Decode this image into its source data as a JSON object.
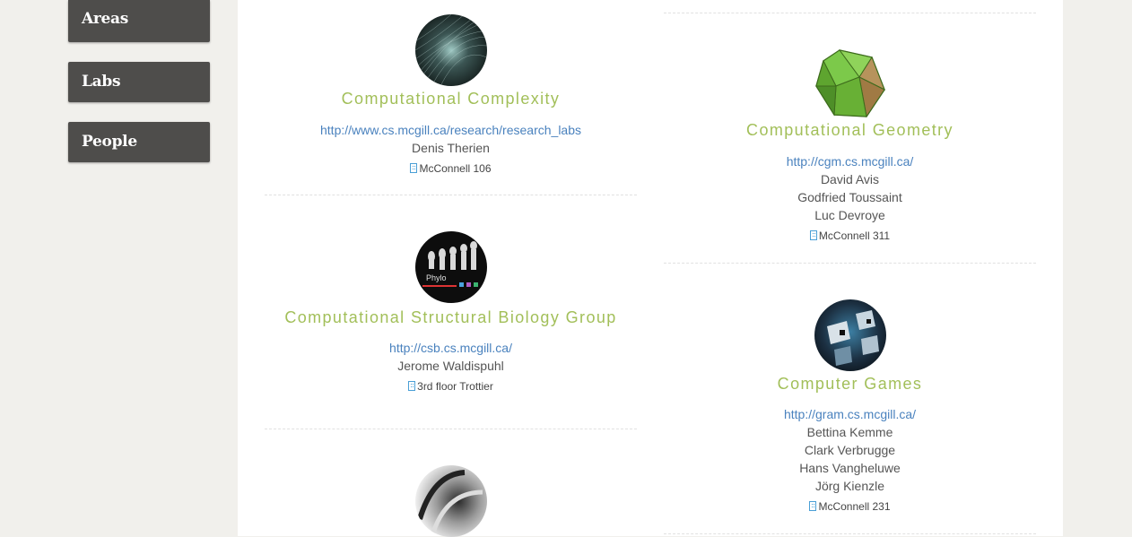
{
  "sidebar": {
    "items": [
      {
        "label": "Areas"
      },
      {
        "label": "Labs"
      },
      {
        "label": "People"
      }
    ]
  },
  "labs": [
    {
      "title": "Computational Complexity",
      "link": "http://www.cs.mcgill.ca/research/research_labs",
      "people": [
        "Denis Therien"
      ],
      "location": "McConnell 106",
      "icon": "building-icon"
    },
    {
      "title": "Computational Structural Biology Group",
      "link": "http://csb.cs.mcgill.ca/",
      "people": [
        "Jerome Waldispuhl"
      ],
      "location": "3rd floor Trottier",
      "image_label": "Phylo",
      "icon": "building-icon"
    },
    {
      "title": "Computational Geometry",
      "link": "http://cgm.cs.mcgill.ca/",
      "people": [
        "David Avis",
        "Godfried Toussaint",
        "Luc Devroye"
      ],
      "location": "McConnell 311",
      "icon": "building-icon"
    },
    {
      "title": "Computer Games",
      "link": "http://gram.cs.mcgill.ca/",
      "people": [
        "Bettina Kemme",
        "Clark Verbrugge",
        "Hans Vangheluwe",
        "Jörg Kienzle"
      ],
      "location": "McConnell 231",
      "icon": "building-icon"
    }
  ],
  "colors": {
    "title_green": "#a2bf59",
    "link_blue": "#4a82be",
    "sidebar_button": "#4e4d4b",
    "page_bg": "#f1f0ec"
  }
}
